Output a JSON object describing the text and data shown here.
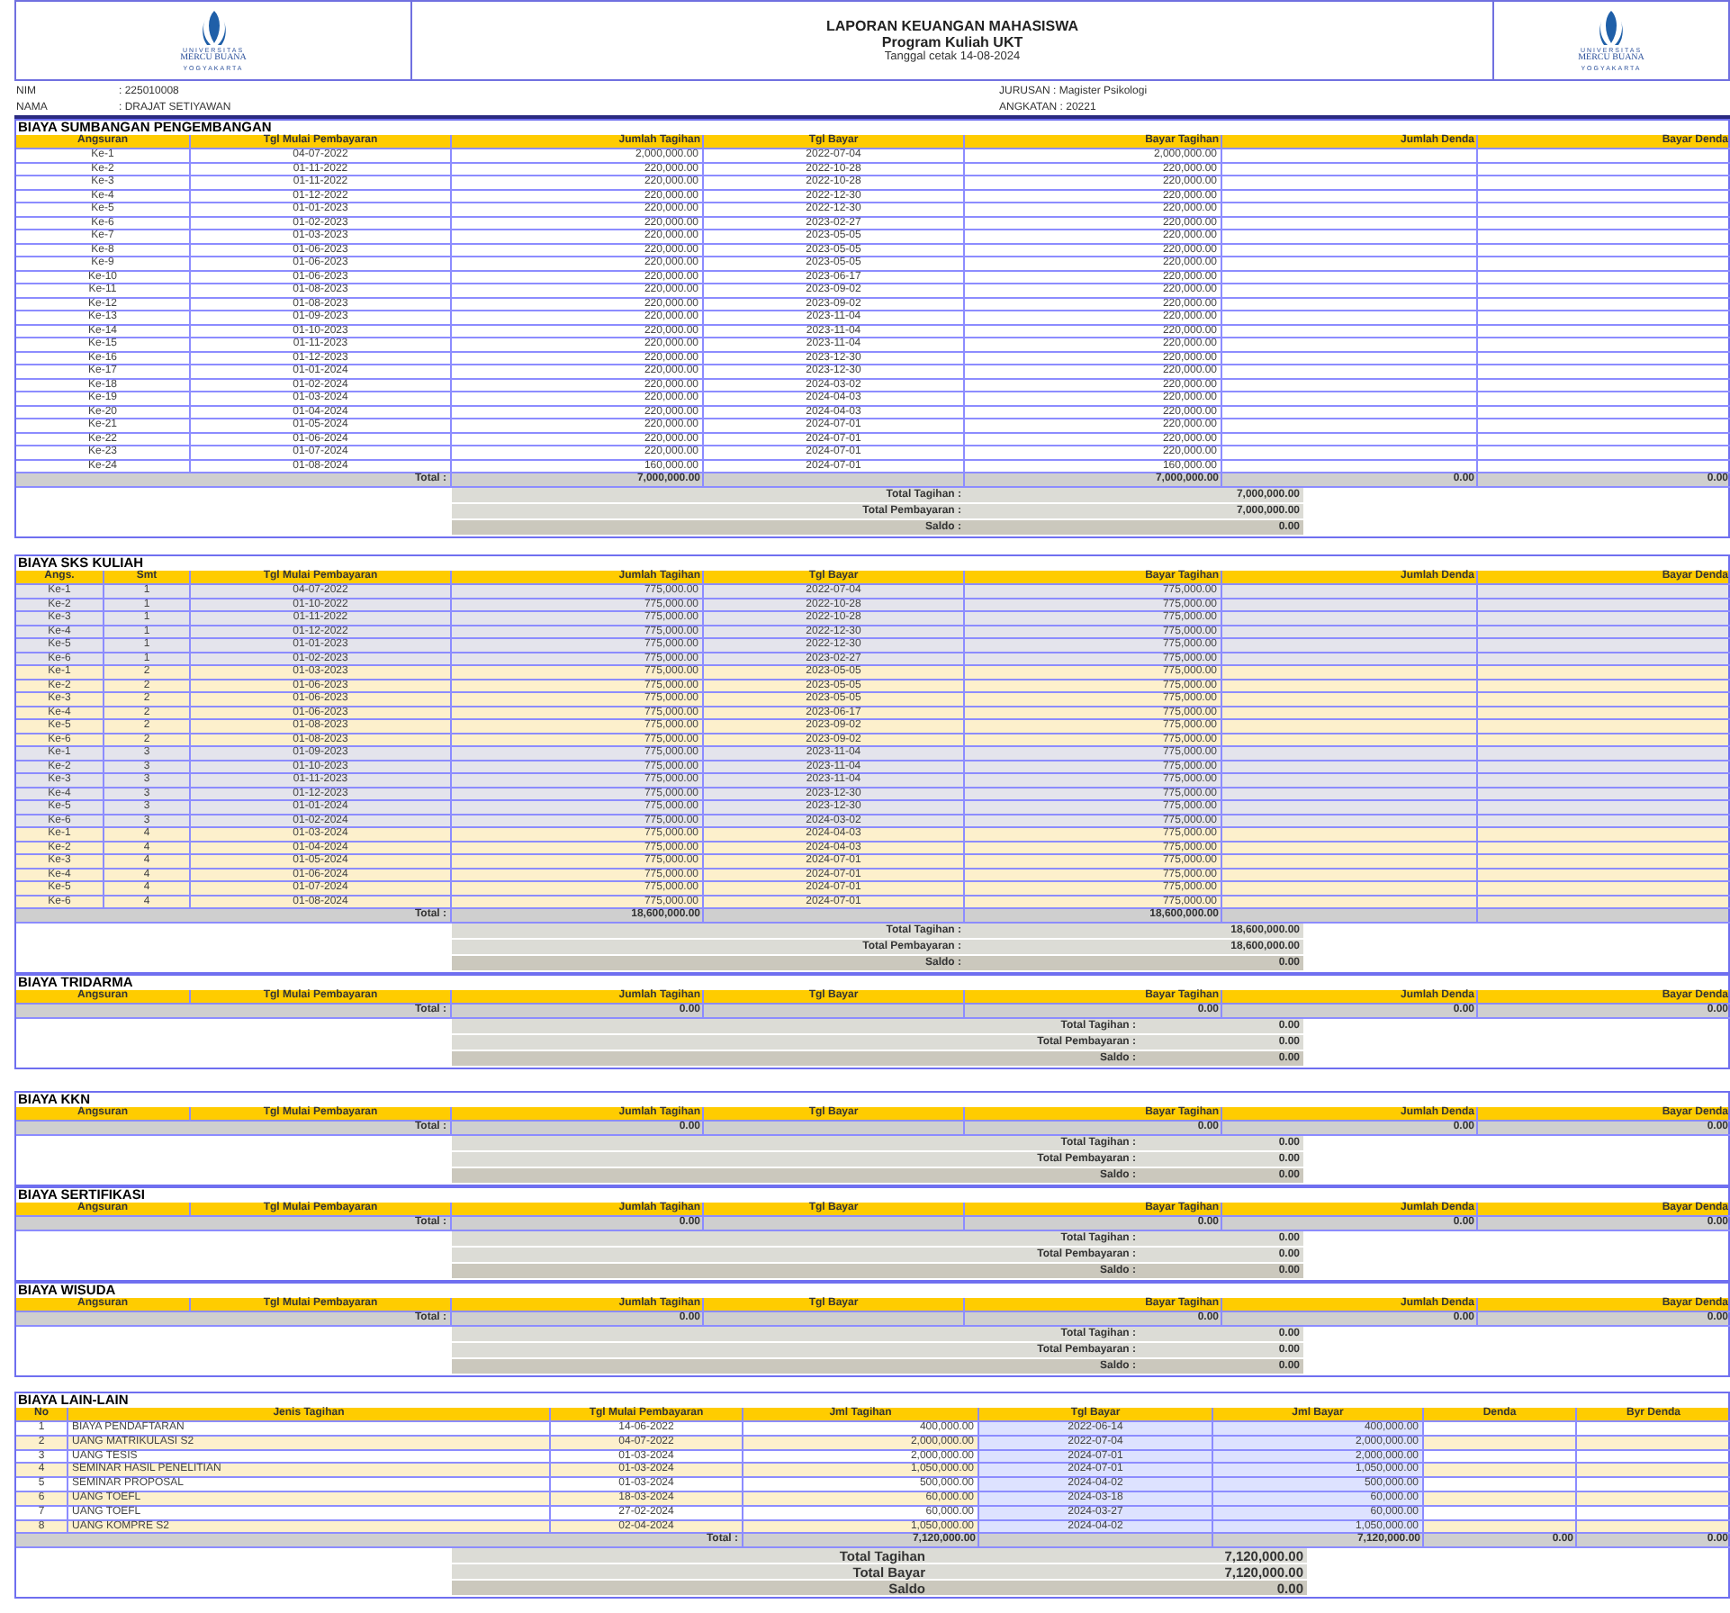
{
  "header": {
    "logos": [
      {
        "lines": [
          "UNIVERSITAS",
          "MERCU BUANA",
          "YOGYAKARTA"
        ]
      },
      {
        "lines": [
          "UNIVERSITAS",
          "MERCU BUANA",
          "YOGYAKARTA"
        ]
      }
    ],
    "title": "LAPORAN KEUANGAN MAHASISWA",
    "subtitle": "Program Kuliah UKT",
    "print_date": "Tanggal cetak 14-08-2024"
  },
  "student": {
    "left": [
      {
        "label": "NIM",
        "value": ": 225010008"
      },
      {
        "label": "NAMA",
        "value": ": DRAJAT SETIYAWAN"
      }
    ],
    "right": [
      "JURUSAN : Magister Psikologi",
      "ANGKATAN : 20221"
    ]
  },
  "sections": [
    {
      "kind": "installments",
      "title": "BIAYA SUMBANGAN PENGEMBANGAN",
      "columns": [
        "Angsuran",
        "Tgl Mulai Pembayaran",
        "Jumlah Tagihan",
        "Tgl Bayar",
        "Bayar Tagihan",
        "Jumlah Denda",
        "Bayar Denda"
      ],
      "groups": [
        {
          "rows": [
            [
              "Ke-1",
              "04-07-2022",
              "2,000,000.00",
              "2022-07-04",
              "2,000,000.00"
            ],
            [
              "Ke-2",
              "01-11-2022",
              "220,000.00",
              "2022-10-28",
              "220,000.00"
            ],
            [
              "Ke-3",
              "01-11-2022",
              "220,000.00",
              "2022-10-28",
              "220,000.00"
            ],
            [
              "Ke-4",
              "01-12-2022",
              "220,000.00",
              "2022-12-30",
              "220,000.00"
            ],
            [
              "Ke-5",
              "01-01-2023",
              "220,000.00",
              "2022-12-30",
              "220,000.00"
            ],
            [
              "Ke-6",
              "01-02-2023",
              "220,000.00",
              "2023-02-27",
              "220,000.00"
            ],
            [
              "Ke-7",
              "01-03-2023",
              "220,000.00",
              "2023-05-05",
              "220,000.00"
            ],
            [
              "Ke-8",
              "01-06-2023",
              "220,000.00",
              "2023-05-05",
              "220,000.00"
            ],
            [
              "Ke-9",
              "01-06-2023",
              "220,000.00",
              "2023-05-05",
              "220,000.00"
            ],
            [
              "Ke-10",
              "01-06-2023",
              "220,000.00",
              "2023-06-17",
              "220,000.00"
            ],
            [
              "Ke-11",
              "01-08-2023",
              "220,000.00",
              "2023-09-02",
              "220,000.00"
            ],
            [
              "Ke-12",
              "01-08-2023",
              "220,000.00",
              "2023-09-02",
              "220,000.00"
            ],
            [
              "Ke-13",
              "01-09-2023",
              "220,000.00",
              "2023-11-04",
              "220,000.00"
            ],
            [
              "Ke-14",
              "01-10-2023",
              "220,000.00",
              "2023-11-04",
              "220,000.00"
            ],
            [
              "Ke-15",
              "01-11-2023",
              "220,000.00",
              "2023-11-04",
              "220,000.00"
            ],
            [
              "Ke-16",
              "01-12-2023",
              "220,000.00",
              "2023-12-30",
              "220,000.00"
            ],
            [
              "Ke-17",
              "01-01-2024",
              "220,000.00",
              "2023-12-30",
              "220,000.00"
            ],
            [
              "Ke-18",
              "01-02-2024",
              "220,000.00",
              "2024-03-02",
              "220,000.00"
            ],
            [
              "Ke-19",
              "01-03-2024",
              "220,000.00",
              "2024-04-03",
              "220,000.00"
            ],
            [
              "Ke-20",
              "01-04-2024",
              "220,000.00",
              "2024-04-03",
              "220,000.00"
            ],
            [
              "Ke-21",
              "01-05-2024",
              "220,000.00",
              "2024-07-01",
              "220,000.00"
            ],
            [
              "Ke-22",
              "01-06-2024",
              "220,000.00",
              "2024-07-01",
              "220,000.00"
            ],
            [
              "Ke-23",
              "01-07-2024",
              "220,000.00",
              "2024-07-01",
              "220,000.00"
            ],
            [
              "Ke-24",
              "01-08-2024",
              "160,000.00",
              "2024-07-01",
              "160,000.00"
            ]
          ]
        }
      ],
      "total": {
        "label": "Total :",
        "cells": [
          "7,000,000.00",
          null,
          "7,000,000.00",
          "0.00",
          "0.00"
        ]
      },
      "summary": [
        {
          "label": "Total Tagihan :",
          "value": "7,000,000.00"
        },
        {
          "label": "Total Pembayaran :",
          "value": "7,000,000.00"
        },
        {
          "label": "Saldo :",
          "value": "0.00"
        }
      ]
    },
    {
      "kind": "semester",
      "title": "BIAYA SKS KULIAH",
      "columns": [
        "Angs.",
        "Smt",
        "Tgl Mulai Pembayaran",
        "Jumlah Tagihan",
        "Tgl Bayar",
        "Bayar Tagihan",
        "Jumlah Denda",
        "Bayar Denda"
      ],
      "groups": [
        {
          "rows": [
            [
              "Ke-1",
              "1",
              "04-07-2022",
              "775,000.00",
              "2022-07-04",
              "775,000.00"
            ],
            [
              "Ke-2",
              "1",
              "01-10-2022",
              "775,000.00",
              "2022-10-28",
              "775,000.00"
            ],
            [
              "Ke-3",
              "1",
              "01-11-2022",
              "775,000.00",
              "2022-10-28",
              "775,000.00"
            ],
            [
              "Ke-4",
              "1",
              "01-12-2022",
              "775,000.00",
              "2022-12-30",
              "775,000.00"
            ],
            [
              "Ke-5",
              "1",
              "01-01-2023",
              "775,000.00",
              "2022-12-30",
              "775,000.00"
            ],
            [
              "Ke-6",
              "1",
              "01-02-2023",
              "775,000.00",
              "2023-02-27",
              "775,000.00"
            ]
          ]
        },
        {
          "rows": [
            [
              "Ke-1",
              "2",
              "01-03-2023",
              "775,000.00",
              "2023-05-05",
              "775,000.00"
            ],
            [
              "Ke-2",
              "2",
              "01-06-2023",
              "775,000.00",
              "2023-05-05",
              "775,000.00"
            ],
            [
              "Ke-3",
              "2",
              "01-06-2023",
              "775,000.00",
              "2023-05-05",
              "775,000.00"
            ],
            [
              "Ke-4",
              "2",
              "01-06-2023",
              "775,000.00",
              "2023-06-17",
              "775,000.00"
            ],
            [
              "Ke-5",
              "2",
              "01-08-2023",
              "775,000.00",
              "2023-09-02",
              "775,000.00"
            ],
            [
              "Ke-6",
              "2",
              "01-08-2023",
              "775,000.00",
              "2023-09-02",
              "775,000.00"
            ]
          ]
        },
        {
          "rows": [
            [
              "Ke-1",
              "3",
              "01-09-2023",
              "775,000.00",
              "2023-11-04",
              "775,000.00"
            ],
            [
              "Ke-2",
              "3",
              "01-10-2023",
              "775,000.00",
              "2023-11-04",
              "775,000.00"
            ],
            [
              "Ke-3",
              "3",
              "01-11-2023",
              "775,000.00",
              "2023-11-04",
              "775,000.00"
            ],
            [
              "Ke-4",
              "3",
              "01-12-2023",
              "775,000.00",
              "2023-12-30",
              "775,000.00"
            ],
            [
              "Ke-5",
              "3",
              "01-01-2024",
              "775,000.00",
              "2023-12-30",
              "775,000.00"
            ],
            [
              "Ke-6",
              "3",
              "01-02-2024",
              "775,000.00",
              "2024-03-02",
              "775,000.00"
            ]
          ]
        },
        {
          "rows": [
            [
              "Ke-1",
              "4",
              "01-03-2024",
              "775,000.00",
              "2024-04-03",
              "775,000.00"
            ],
            [
              "Ke-2",
              "4",
              "01-04-2024",
              "775,000.00",
              "2024-04-03",
              "775,000.00"
            ],
            [
              "Ke-3",
              "4",
              "01-05-2024",
              "775,000.00",
              "2024-07-01",
              "775,000.00"
            ],
            [
              "Ke-4",
              "4",
              "01-06-2024",
              "775,000.00",
              "2024-07-01",
              "775,000.00"
            ],
            [
              "Ke-5",
              "4",
              "01-07-2024",
              "775,000.00",
              "2024-07-01",
              "775,000.00"
            ],
            [
              "Ke-6",
              "4",
              "01-08-2024",
              "775,000.00",
              "2024-07-01",
              "775,000.00"
            ]
          ]
        }
      ],
      "total": {
        "label": "Total :",
        "cells": [
          "18,600,000.00",
          null,
          "18,600,000.00",
          null,
          null
        ]
      },
      "summary": [
        {
          "label": "Total Tagihan :",
          "value": "18,600,000.00"
        },
        {
          "label": "Total Pembayaran :",
          "value": "18,600,000.00"
        },
        {
          "label": "Saldo :",
          "value": "0.00"
        }
      ]
    },
    {
      "kind": "empty",
      "title": "BIAYA TRIDARMA",
      "columns": [
        "Angsuran",
        "Tgl Mulai Pembayaran",
        "Jumlah Tagihan",
        "Tgl Bayar",
        "Bayar Tagihan",
        "Jumlah Denda",
        "Bayar Denda"
      ],
      "total": {
        "label": "Total :",
        "cells": [
          "0.00",
          null,
          "0.00",
          "0.00",
          "0.00"
        ]
      },
      "summary": [
        {
          "label": "Total Tagihan :",
          "value": "0.00"
        },
        {
          "label": "Total Pembayaran :",
          "value": "0.00"
        },
        {
          "label": "Saldo :",
          "value": "0.00"
        }
      ]
    },
    {
      "kind": "empty",
      "title": "BIAYA KKN",
      "columns": [
        "Angsuran",
        "Tgl Mulai Pembayaran",
        "Jumlah Tagihan",
        "Tgl Bayar",
        "Bayar Tagihan",
        "Jumlah Denda",
        "Bayar Denda"
      ],
      "total": {
        "label": "Total :",
        "cells": [
          "0.00",
          null,
          "0.00",
          "0.00",
          "0.00"
        ]
      },
      "summary": [
        {
          "label": "Total Tagihan :",
          "value": "0.00"
        },
        {
          "label": "Total Pembayaran :",
          "value": "0.00"
        },
        {
          "label": "Saldo :",
          "value": "0.00"
        }
      ]
    },
    {
      "kind": "empty",
      "title": "BIAYA SERTIFIKASI",
      "columns": [
        "Angsuran",
        "Tgl Mulai Pembayaran",
        "Jumlah Tagihan",
        "Tgl Bayar",
        "Bayar Tagihan",
        "Jumlah Denda",
        "Bayar Denda"
      ],
      "total": {
        "label": "Total :",
        "cells": [
          "0.00",
          null,
          "0.00",
          "0.00",
          "0.00"
        ]
      },
      "summary": [
        {
          "label": "Total Tagihan :",
          "value": "0.00"
        },
        {
          "label": "Total Pembayaran :",
          "value": "0.00"
        },
        {
          "label": "Saldo :",
          "value": "0.00"
        }
      ]
    },
    {
      "kind": "empty",
      "title": "BIAYA WISUDA",
      "columns": [
        "Angsuran",
        "Tgl Mulai Pembayaran",
        "Jumlah Tagihan",
        "Tgl Bayar",
        "Bayar Tagihan",
        "Jumlah Denda",
        "Bayar Denda"
      ],
      "total": {
        "label": "Total :",
        "cells": [
          "0.00",
          null,
          "0.00",
          "0.00",
          "0.00"
        ]
      },
      "summary": [
        {
          "label": "Total Tagihan :",
          "value": "0.00"
        },
        {
          "label": "Total Pembayaran :",
          "value": "0.00"
        },
        {
          "label": "Saldo :",
          "value": "0.00"
        }
      ]
    },
    {
      "kind": "other",
      "title": "BIAYA LAIN-LAIN",
      "columns": [
        "No",
        "Jenis Tagihan",
        "Tgl Mulai Pembayaran",
        "Jml Tagihan",
        "Tgl Bayar",
        "Jml Bayar",
        "Denda",
        "Byr Denda"
      ],
      "groups": [
        {
          "rows": [
            [
              "1",
              "BIAYA PENDAFTARAN",
              "14-06-2022",
              "400,000.00",
              "2022-06-14",
              "400,000.00"
            ],
            [
              "2",
              "UANG MATRIKULASI S2",
              "04-07-2022",
              "2,000,000.00",
              "2022-07-04",
              "2,000,000.00"
            ],
            [
              "3",
              "UANG TESIS",
              "01-03-2024",
              "2,000,000.00",
              "2024-07-01",
              "2,000,000.00"
            ],
            [
              "4",
              "SEMINAR HASIL PENELITIAN",
              "01-03-2024",
              "1,050,000.00",
              "2024-07-01",
              "1,050,000.00"
            ],
            [
              "5",
              "SEMINAR PROPOSAL",
              "01-03-2024",
              "500,000.00",
              "2024-04-02",
              "500,000.00"
            ],
            [
              "6",
              "UANG TOEFL",
              "18-03-2024",
              "60,000.00",
              "2024-03-18",
              "60,000.00"
            ],
            [
              "7",
              "UANG TOEFL",
              "27-02-2024",
              "60,000.00",
              "2024-03-27",
              "60,000.00"
            ],
            [
              "8",
              "UANG KOMPRE S2",
              "02-04-2024",
              "1,050,000.00",
              "2024-04-02",
              "1,050,000.00"
            ]
          ]
        }
      ],
      "total": {
        "label": "Total :",
        "cells": [
          "7,120,000.00",
          null,
          "7,120,000.00",
          "0.00",
          "0.00"
        ]
      },
      "summary": [
        {
          "label": "Total Tagihan",
          "value": "7,120,000.00"
        },
        {
          "label": "Total Bayar",
          "value": "7,120,000.00"
        },
        {
          "label": "Saldo",
          "value": "0.00"
        }
      ]
    }
  ]
}
